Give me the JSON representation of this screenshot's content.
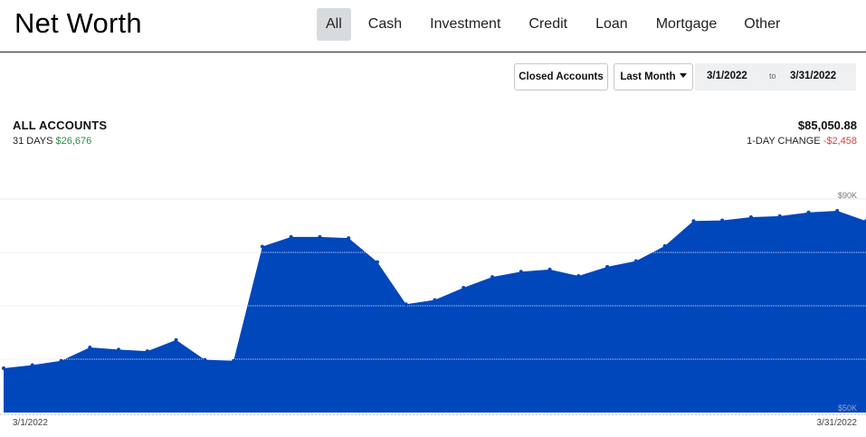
{
  "header": {
    "title": "Net Worth",
    "tabs": [
      {
        "label": "All",
        "active": true
      },
      {
        "label": "Cash",
        "active": false
      },
      {
        "label": "Investment",
        "active": false
      },
      {
        "label": "Credit",
        "active": false
      },
      {
        "label": "Loan",
        "active": false
      },
      {
        "label": "Mortgage",
        "active": false
      },
      {
        "label": "Other",
        "active": false
      }
    ]
  },
  "controls": {
    "closed_accounts_label": "Closed Accounts",
    "range_label": "Last Month",
    "start_date": "3/1/2022",
    "to_label": "to",
    "end_date": "3/31/2022"
  },
  "summary": {
    "title": "ALL ACCOUNTS",
    "days_label": "31 DAYS",
    "days_change": "$26,676",
    "total": "$85,050.88",
    "day_change_label": "1-DAY CHANGE",
    "day_change": "-$2,458"
  },
  "colors": {
    "area_fill": "#0047BB",
    "positive": "#2e8b3e",
    "negative": "#d0453c"
  },
  "chart_data": {
    "type": "area",
    "x_labels": [
      "3/1/2022",
      "3/31/2022"
    ],
    "y_tick_labels": [
      "$90K",
      "$50K"
    ],
    "ylim": [
      50000,
      90000
    ],
    "grid": true,
    "series": [
      {
        "values": [
          58300,
          58900,
          59700,
          62200,
          61800,
          61500,
          63600,
          59900,
          59700,
          81100,
          82900,
          82900,
          82700,
          78200,
          70300,
          71100,
          73400,
          75400,
          76400,
          76800,
          75600,
          77300,
          78400,
          81200,
          85900,
          86000,
          86600,
          86800,
          87500,
          87800,
          85900
        ]
      }
    ]
  }
}
